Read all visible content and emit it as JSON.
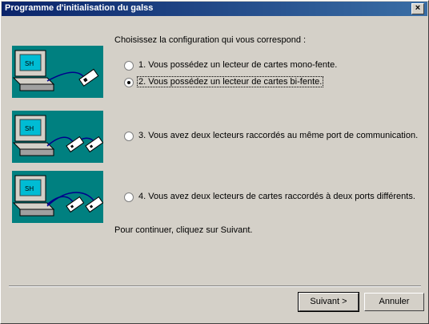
{
  "window": {
    "title": "Programme d'initialisation du galss",
    "close_glyph": "×"
  },
  "intro": "Choisissez la configuration qui vous correspond :",
  "options": [
    {
      "label": "1. Vous possédez un lecteur de cartes mono-fente.",
      "checked": false
    },
    {
      "label": "2. Vous possédez un lecteur de cartes bi-fente.",
      "checked": true
    },
    {
      "label": "3. Vous avez deux lecteurs raccordés au même port de communication.",
      "checked": false
    },
    {
      "label": "4. Vous avez deux lecteurs de cartes raccordés à deux ports différents.",
      "checked": false
    }
  ],
  "footer_text": "Pour continuer, cliquez sur Suivant.",
  "buttons": {
    "next": "Suivant >",
    "cancel": "Annuler"
  },
  "illustration": {
    "screen_text": "SH",
    "bg_color": "#008080"
  }
}
